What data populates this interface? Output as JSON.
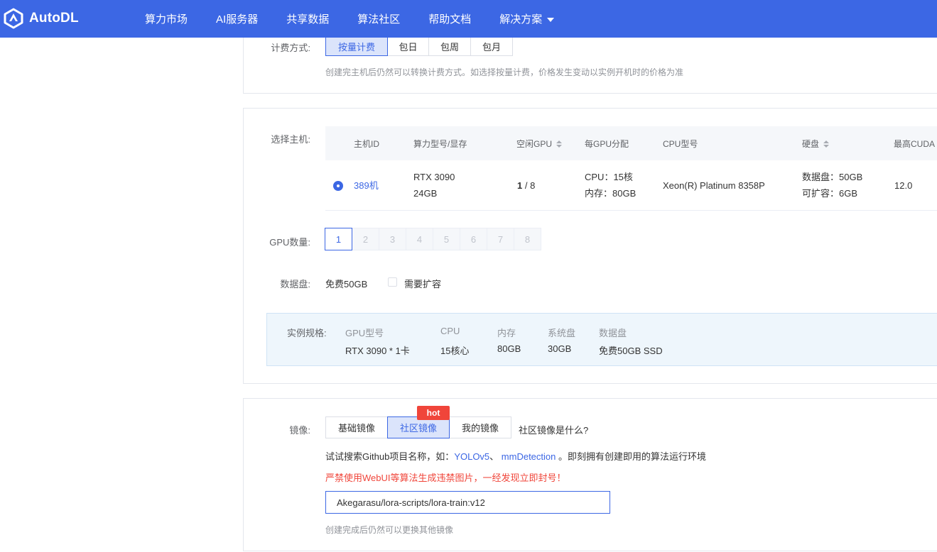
{
  "header": {
    "logo_text": "AutoDL",
    "nav": [
      {
        "label": "算力市场"
      },
      {
        "label": "AI服务器"
      },
      {
        "label": "共享数据"
      },
      {
        "label": "算法社区"
      },
      {
        "label": "帮助文档"
      },
      {
        "label": "解决方案",
        "has_dropdown": true
      }
    ]
  },
  "billing": {
    "label": "计费方式:",
    "options": [
      {
        "label": "按量计费",
        "selected": true
      },
      {
        "label": "包日",
        "selected": false
      },
      {
        "label": "包周",
        "selected": false
      },
      {
        "label": "包月",
        "selected": false
      }
    ],
    "hint": "创建完主机后仍然可以转换计费方式。如选择按量计费，价格发生变动以实例开机时的价格为准"
  },
  "host": {
    "label": "选择主机:",
    "columns": {
      "id": "主机ID",
      "model": "算力型号/显存",
      "free_gpu": "空闲GPU",
      "per_gpu": "每GPU分配",
      "cpu": "CPU型号",
      "disk": "硬盘",
      "cuda": "最高CUDA"
    },
    "row": {
      "id": "389机",
      "model_line1": "RTX 3090",
      "model_line2": "24GB",
      "free_gpu_count": "1",
      "free_gpu_total": " / 8",
      "per_gpu_line1": "CPU：15核",
      "per_gpu_line2": "内存：80GB",
      "cpu": "Xeon(R) Platinum 8358P",
      "disk_line1": "数据盘：50GB",
      "disk_line2": "可扩容：6GB",
      "cuda": "12.0",
      "selected": true
    }
  },
  "gpu_count": {
    "label": "GPU数量:",
    "options": [
      "1",
      "2",
      "3",
      "4",
      "5",
      "6",
      "7",
      "8"
    ],
    "selected": "1"
  },
  "data_disk": {
    "label": "数据盘:",
    "value": "免费50GB",
    "expand_label": "需要扩容",
    "expand_checked": false
  },
  "spec": {
    "label": "实例规格:",
    "items": [
      {
        "header": "GPU型号",
        "value": "RTX 3090 * 1卡"
      },
      {
        "header": "CPU",
        "value": "15核心"
      },
      {
        "header": "内存",
        "value": "80GB"
      },
      {
        "header": "系统盘",
        "value": "30GB"
      },
      {
        "header": "数据盘",
        "value": "免费50GB SSD"
      }
    ]
  },
  "image": {
    "label": "镜像:",
    "tabs": [
      {
        "label": "基础镜像",
        "selected": false
      },
      {
        "label": "社区镜像",
        "selected": true
      },
      {
        "label": "我的镜像",
        "selected": false
      }
    ],
    "hot_badge": "hot",
    "what_link": "社区镜像是什么?",
    "search_hint_prefix": "试试搜索Github项目名称，如：",
    "search_example_1": "YOLOv5",
    "search_sep": "、 ",
    "search_example_2": "mmDetection",
    "search_hint_suffix": " 。即刻拥有创建即用的算法运行环境",
    "warning": "严禁使用WebUI等算法生成违禁图片，一经发现立即封号！",
    "input_value": "Akegarasu/lora-scripts/lora-train:v12",
    "footer_hint": "创建完成后仍然可以更换其他镜像"
  },
  "colors": {
    "primary": "#3c67e4",
    "hot": "#f0453a",
    "spec_bg": "#eef6fc"
  }
}
